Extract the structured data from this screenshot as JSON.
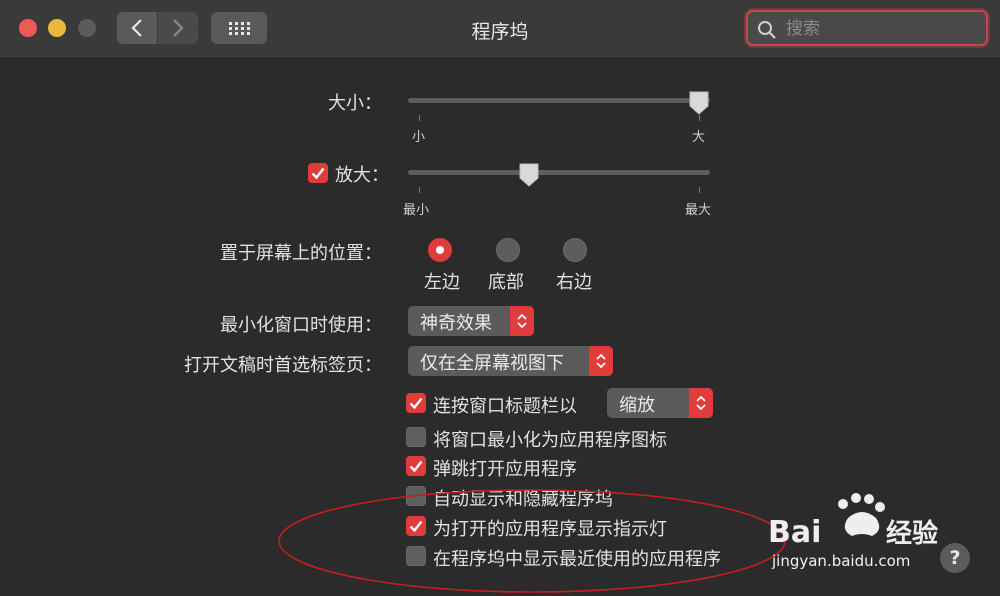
{
  "window": {
    "title": "程序坞"
  },
  "search": {
    "placeholder": "搜索"
  },
  "size": {
    "label": "大小：",
    "min_label": "小",
    "max_label": "大",
    "value_fraction": 1.0
  },
  "magnification": {
    "label": "放大：",
    "checked": true,
    "min_label": "最小",
    "max_label": "最大",
    "value_fraction": 0.4
  },
  "position": {
    "label": "置于屏幕上的位置：",
    "options": [
      {
        "label": "左边",
        "selected": true
      },
      {
        "label": "底部",
        "selected": false
      },
      {
        "label": "右边",
        "selected": false
      }
    ]
  },
  "minimize_effect": {
    "label": "最小化窗口时使用：",
    "value": "神奇效果"
  },
  "prefer_tabs": {
    "label": "打开文稿时首选标签页：",
    "value": "仅在全屏幕视图下"
  },
  "double_click": {
    "label": "连按窗口标题栏以",
    "checked": true,
    "value": "缩放"
  },
  "checkboxes": [
    {
      "label": "将窗口最小化为应用程序图标",
      "checked": false
    },
    {
      "label": "弹跳打开应用程序",
      "checked": true
    },
    {
      "label": "自动显示和隐藏程序坞",
      "checked": false
    },
    {
      "label": "为打开的应用程序显示指示灯",
      "checked": true
    },
    {
      "label": "在程序坞中显示最近使用的应用程序",
      "checked": false
    }
  ],
  "help": {
    "label": "?"
  },
  "watermark": {
    "brand": "Bai",
    "brand_suffix": "经验",
    "url": "jingyan.baidu.com"
  },
  "colors": {
    "accent": "#e03c3c",
    "background": "#2b2b2b",
    "annotation": "#c41e1e"
  }
}
